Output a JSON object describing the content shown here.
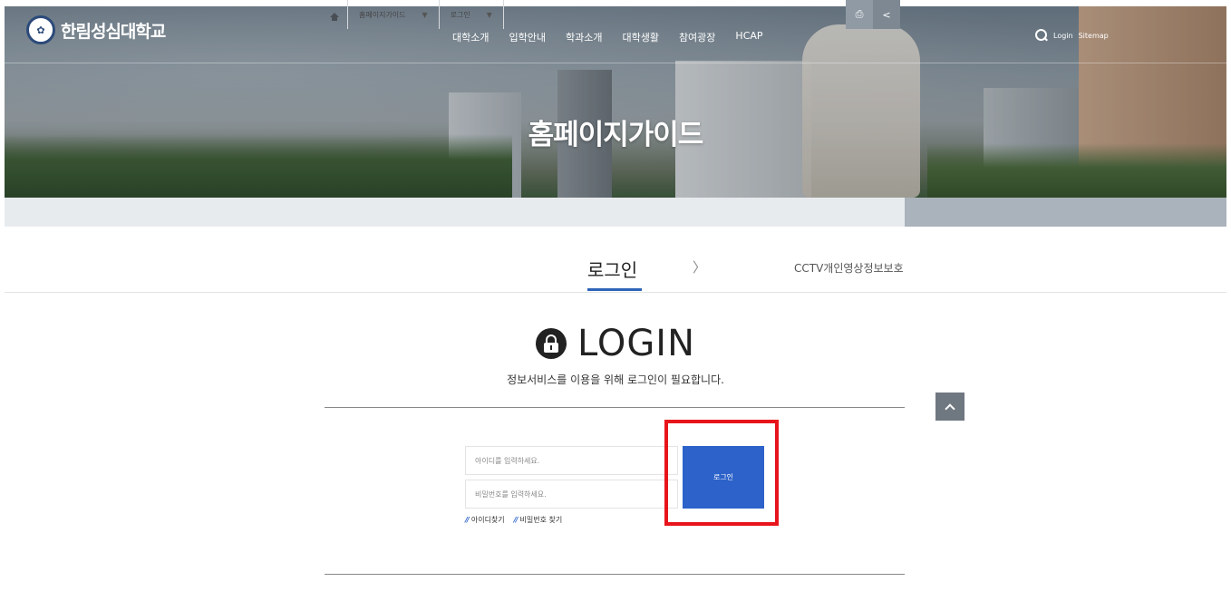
{
  "header": {
    "logo_text": "한림성심대학교",
    "nav": [
      "대학소개",
      "입학안내",
      "학과소개",
      "대학생활",
      "참여광장",
      "HCAP"
    ],
    "util": {
      "login": "Login",
      "sitemap": "Sitemap"
    },
    "page_title": "홈페이지가이드"
  },
  "breadcrumb": {
    "level1": "홈페이지가이드",
    "level2": "로그인"
  },
  "tabs": {
    "active": "로그인",
    "separator": "〉",
    "next": "CCTV개인영상정보보호"
  },
  "login": {
    "title": "LOGIN",
    "subtitle": "정보서비스를 이용을 위해 로그인이 필요합니다.",
    "id_placeholder": "아이디를 입력하세요.",
    "pw_placeholder": "비밀번호를 입력하세요.",
    "button": "로그인",
    "find_id": "아이디찾기",
    "find_pw": "비밀번호 찾기",
    "link_mark": "//"
  },
  "colors": {
    "accent": "#2c62c9",
    "highlight": "#e8141b",
    "crumb_tools": "#8f9aa4"
  },
  "icons": [
    "search-icon",
    "home-icon",
    "print-icon",
    "share-icon",
    "lock-icon",
    "arrow-up-icon"
  ]
}
